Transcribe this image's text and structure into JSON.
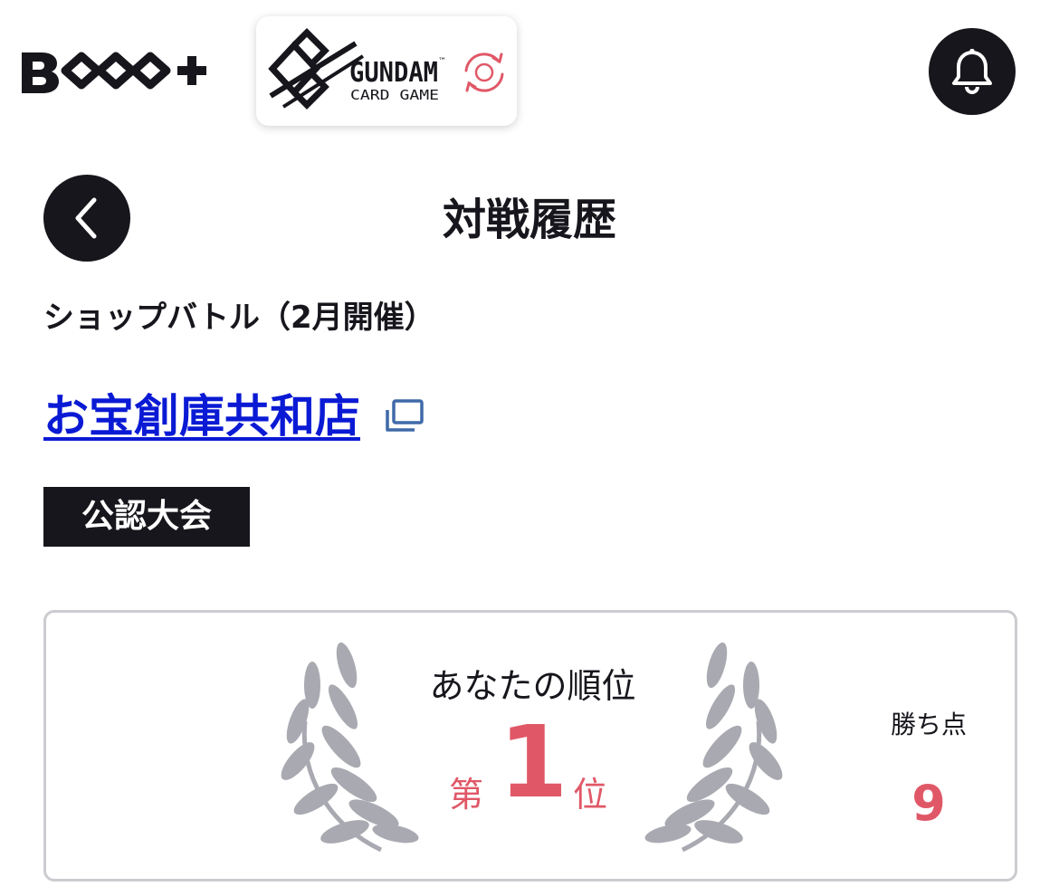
{
  "header": {
    "brand_logo_text": "B TCG +",
    "game_logo": {
      "title": "GUNDAM",
      "subtitle": "CARD GAME",
      "trademark": "™"
    },
    "notification_icon": "bell-icon"
  },
  "page": {
    "title": "対戦履歴",
    "back_icon": "chevron-left-icon"
  },
  "event": {
    "name": "ショップバトル（2月開催）",
    "shop_name": "お宝創庫共和店",
    "shop_link_icon": "external-window-icon",
    "badge": "公認大会"
  },
  "result": {
    "rank_label": "あなたの順位",
    "rank_prefix": "第",
    "rank": "1",
    "rank_suffix": "位",
    "points_label": "勝ち点",
    "points": "9",
    "wreath_icon": "laurel-wreath-icon"
  },
  "colors": {
    "dark": "#16161c",
    "link": "#0a1ad4",
    "accent": "#e05867",
    "wreath": "#a9a9b1",
    "card_border": "#cbcbd0"
  }
}
